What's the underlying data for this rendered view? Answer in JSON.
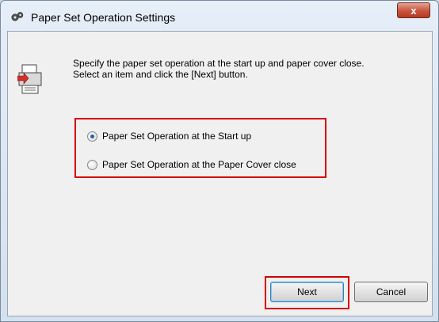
{
  "window": {
    "title": "Paper Set Operation Settings",
    "close_glyph": "x"
  },
  "instructions": {
    "line1": "Specify the paper set operation at the start up and paper cover close.",
    "line2": "Select an item and click the [Next] button."
  },
  "options": [
    {
      "label": "Paper Set Operation at the Start up",
      "selected": true
    },
    {
      "label": "Paper Set Operation at the Paper Cover close",
      "selected": false
    }
  ],
  "buttons": {
    "next": "Next",
    "cancel": "Cancel"
  },
  "colors": {
    "highlight": "#d40000",
    "close_button": "#c9533c"
  },
  "icons": [
    "gear-icon",
    "printer-icon",
    "close-icon"
  ]
}
